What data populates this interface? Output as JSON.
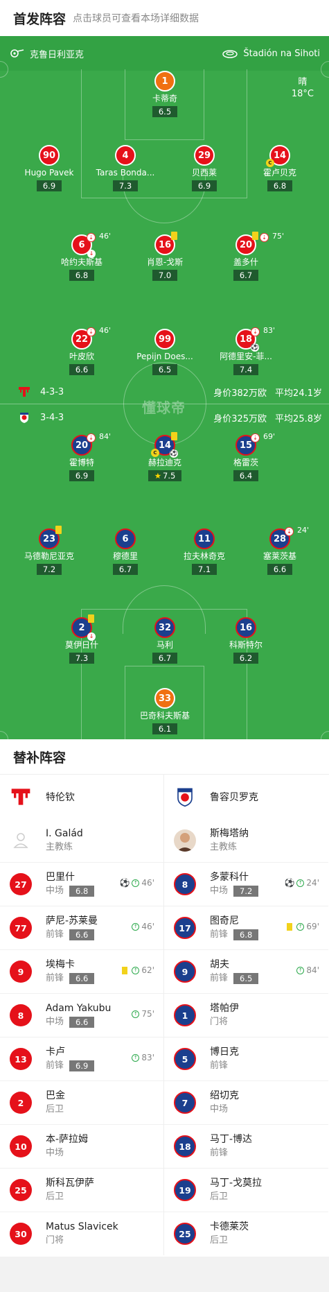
{
  "header": {
    "title": "首发阵容",
    "subtitle": "点击球员可查看本场详细数据"
  },
  "venue": {
    "home_team": "克鲁日利亚克",
    "stadium": "Štadión na Sihoti"
  },
  "weather": {
    "condition": "晴",
    "temp": "18°C"
  },
  "home": {
    "formation": "4-3-3",
    "value": "身价382万欧",
    "age": "平均24.1岁",
    "players": [
      {
        "num": "1",
        "name": "卡蒂奇",
        "rating": "6.5",
        "kit": "o"
      },
      {
        "num": "90",
        "name": "Hugo Pavek",
        "rating": "6.9",
        "kit": "r"
      },
      {
        "num": "4",
        "name": "Taras Bonda...",
        "rating": "7.3",
        "kit": "r"
      },
      {
        "num": "29",
        "name": "贝西莱",
        "rating": "6.9",
        "kit": "r"
      },
      {
        "num": "14",
        "name": "霍卢贝克",
        "rating": "6.8",
        "kit": "r"
      },
      {
        "num": "6",
        "name": "哈约夫斯基",
        "rating": "6.8",
        "kit": "r",
        "sub": "46'"
      },
      {
        "num": "16",
        "name": "肖恩-戈斯",
        "rating": "7.0",
        "kit": "r"
      },
      {
        "num": "20",
        "name": "盖多什",
        "rating": "6.7",
        "kit": "r",
        "sub": "75'"
      },
      {
        "num": "22",
        "name": "叶皮欣",
        "rating": "6.6",
        "kit": "r",
        "sub": "46'"
      },
      {
        "num": "99",
        "name": "Pepijn Does...",
        "rating": "6.5",
        "kit": "r"
      },
      {
        "num": "18",
        "name": "阿德里安-菲...",
        "rating": "7.4",
        "kit": "r",
        "sub": "83'"
      }
    ]
  },
  "away": {
    "formation": "3-4-3",
    "value": "身价325万欧",
    "age": "平均25.8岁",
    "players": [
      {
        "num": "20",
        "name": "霍博特",
        "rating": "6.9",
        "kit": "b",
        "sub": "84'"
      },
      {
        "num": "14",
        "name": "赫拉迪克",
        "rating": "7.5",
        "kit": "b"
      },
      {
        "num": "15",
        "name": "格雷茨",
        "rating": "6.4",
        "kit": "b",
        "sub": "69'"
      },
      {
        "num": "23",
        "name": "马德勒尼亚克",
        "rating": "7.2",
        "kit": "b"
      },
      {
        "num": "6",
        "name": "穆德里",
        "rating": "6.7",
        "kit": "b"
      },
      {
        "num": "11",
        "name": "拉夫林奇克",
        "rating": "7.1",
        "kit": "b"
      },
      {
        "num": "28",
        "name": "塞莱茨基",
        "rating": "6.6",
        "kit": "b",
        "sub": "24'"
      },
      {
        "num": "2",
        "name": "莫伊日什",
        "rating": "7.3",
        "kit": "b"
      },
      {
        "num": "32",
        "name": "马利",
        "rating": "6.7",
        "kit": "b"
      },
      {
        "num": "16",
        "name": "科斯特尔",
        "rating": "6.2",
        "kit": "b"
      },
      {
        "num": "33",
        "name": "巴奇科夫斯基",
        "rating": "6.1",
        "kit": "o"
      }
    ]
  },
  "watermark": "懂球帝",
  "subs": {
    "title": "替补阵容",
    "home": {
      "team": "特伦钦",
      "coach": {
        "name": "I. Galád",
        "role": "主教练"
      },
      "players": [
        {
          "num": "27",
          "name": "巴里什",
          "pos": "中场",
          "rating": "6.8",
          "goal": true,
          "yellow": false,
          "in": "46'"
        },
        {
          "num": "77",
          "name": "萨尼-苏莱曼",
          "pos": "前锋",
          "rating": "6.6",
          "goal": false,
          "yellow": false,
          "in": "46'"
        },
        {
          "num": "9",
          "name": "埃梅卡",
          "pos": "前锋",
          "rating": "6.6",
          "goal": false,
          "yellow": true,
          "in": "62'"
        },
        {
          "num": "8",
          "name": "Adam Yakubu",
          "pos": "中场",
          "rating": "6.6",
          "goal": false,
          "yellow": false,
          "in": "75'"
        },
        {
          "num": "13",
          "name": "卡卢",
          "pos": "前锋",
          "rating": "6.9",
          "goal": false,
          "yellow": false,
          "in": "83'"
        },
        {
          "num": "2",
          "name": "巴金",
          "pos": "后卫",
          "rating": "",
          "goal": false,
          "yellow": false,
          "in": ""
        },
        {
          "num": "10",
          "name": "本-萨拉姆",
          "pos": "中场",
          "rating": "",
          "goal": false,
          "yellow": false,
          "in": ""
        },
        {
          "num": "25",
          "name": "斯科瓦伊萨",
          "pos": "后卫",
          "rating": "",
          "goal": false,
          "yellow": false,
          "in": ""
        },
        {
          "num": "30",
          "name": "Matus Slavicek",
          "pos": "门将",
          "rating": "",
          "goal": false,
          "yellow": false,
          "in": ""
        }
      ]
    },
    "away": {
      "team": "鲁容贝罗克",
      "coach": {
        "name": "斯梅塔纳",
        "role": "主教练"
      },
      "players": [
        {
          "num": "8",
          "name": "多蒙科什",
          "pos": "中场",
          "rating": "7.2",
          "goal": true,
          "yellow": false,
          "in": "24'"
        },
        {
          "num": "17",
          "name": "图奇尼",
          "pos": "前锋",
          "rating": "6.8",
          "goal": false,
          "yellow": true,
          "in": "69'"
        },
        {
          "num": "9",
          "name": "胡夫",
          "pos": "前锋",
          "rating": "6.5",
          "goal": false,
          "yellow": false,
          "in": "84'"
        },
        {
          "num": "1",
          "name": "塔帕伊",
          "pos": "门将",
          "rating": "",
          "goal": false,
          "yellow": false,
          "in": ""
        },
        {
          "num": "5",
          "name": "博日克",
          "pos": "前锋",
          "rating": "",
          "goal": false,
          "yellow": false,
          "in": ""
        },
        {
          "num": "7",
          "name": "绍切克",
          "pos": "中场",
          "rating": "",
          "goal": false,
          "yellow": false,
          "in": ""
        },
        {
          "num": "18",
          "name": "马丁-博达",
          "pos": "前锋",
          "rating": "",
          "goal": false,
          "yellow": false,
          "in": ""
        },
        {
          "num": "19",
          "name": "马丁-戈莫拉",
          "pos": "后卫",
          "rating": "",
          "goal": false,
          "yellow": false,
          "in": ""
        },
        {
          "num": "25",
          "name": "卡德莱茨",
          "pos": "后卫",
          "rating": "",
          "goal": false,
          "yellow": false,
          "in": ""
        }
      ]
    }
  }
}
